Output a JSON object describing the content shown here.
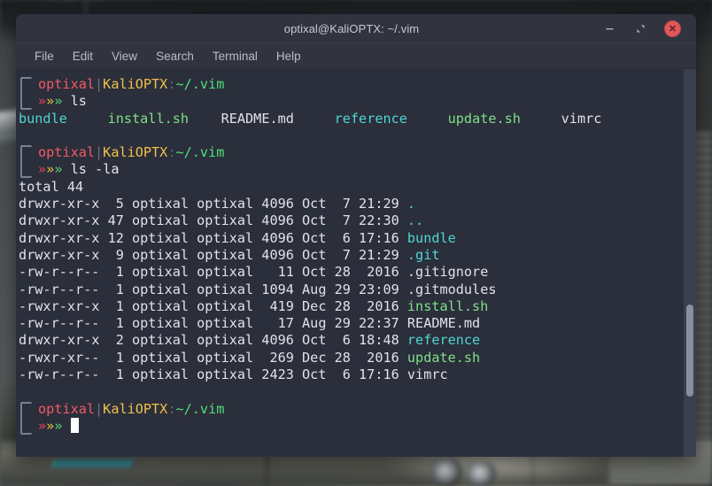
{
  "window": {
    "title": "optixal@KaliOPTX: ~/.vim",
    "controls": {
      "minimize": "minimize-button",
      "maximize": "maximize-button",
      "close_glyph": "✕"
    }
  },
  "menubar": {
    "items": [
      {
        "label": "File"
      },
      {
        "label": "Edit"
      },
      {
        "label": "View"
      },
      {
        "label": "Search"
      },
      {
        "label": "Terminal"
      },
      {
        "label": "Help"
      }
    ]
  },
  "prompt": {
    "user": "optixal",
    "separator": "|",
    "host": "KaliOPTX",
    "colon": ":",
    "path": "~/.vim",
    "arrow": "»"
  },
  "terminal": {
    "commands": {
      "first": "ls",
      "second": "ls -la"
    },
    "ls_entries": [
      {
        "name": "bundle",
        "type": "dir"
      },
      {
        "name": "install.sh",
        "type": "exec"
      },
      {
        "name": "README.md",
        "type": "file"
      },
      {
        "name": "reference",
        "type": "dir"
      },
      {
        "name": "update.sh",
        "type": "exec"
      },
      {
        "name": "vimrc",
        "type": "file"
      }
    ],
    "total_line": "total 44",
    "long_listing": [
      {
        "perms": "drwxr-xr-x",
        "links": "5",
        "owner": "optixal",
        "group": "optixal",
        "size": "4096",
        "month": "Oct",
        "day": "7",
        "time": "21:29",
        "name": ".",
        "type": "dir"
      },
      {
        "perms": "drwxr-xr-x",
        "links": "47",
        "owner": "optixal",
        "group": "optixal",
        "size": "4096",
        "month": "Oct",
        "day": "7",
        "time": "22:30",
        "name": "..",
        "type": "dir"
      },
      {
        "perms": "drwxr-xr-x",
        "links": "12",
        "owner": "optixal",
        "group": "optixal",
        "size": "4096",
        "month": "Oct",
        "day": "6",
        "time": "17:16",
        "name": "bundle",
        "type": "dir"
      },
      {
        "perms": "drwxr-xr-x",
        "links": "9",
        "owner": "optixal",
        "group": "optixal",
        "size": "4096",
        "month": "Oct",
        "day": "7",
        "time": "21:29",
        "name": ".git",
        "type": "dir"
      },
      {
        "perms": "-rw-r--r--",
        "links": "1",
        "owner": "optixal",
        "group": "optixal",
        "size": "11",
        "month": "Oct",
        "day": "28",
        "time": "2016",
        "name": ".gitignore",
        "type": "file"
      },
      {
        "perms": "-rw-r--r--",
        "links": "1",
        "owner": "optixal",
        "group": "optixal",
        "size": "1094",
        "month": "Aug",
        "day": "29",
        "time": "23:09",
        "name": ".gitmodules",
        "type": "file"
      },
      {
        "perms": "-rwxr-xr-x",
        "links": "1",
        "owner": "optixal",
        "group": "optixal",
        "size": "419",
        "month": "Dec",
        "day": "28",
        "time": "2016",
        "name": "install.sh",
        "type": "exec"
      },
      {
        "perms": "-rw-r--r--",
        "links": "1",
        "owner": "optixal",
        "group": "optixal",
        "size": "17",
        "month": "Aug",
        "day": "29",
        "time": "22:37",
        "name": "README.md",
        "type": "file"
      },
      {
        "perms": "drwxr-xr-x",
        "links": "2",
        "owner": "optixal",
        "group": "optixal",
        "size": "4096",
        "month": "Oct",
        "day": "6",
        "time": "18:48",
        "name": "reference",
        "type": "dir"
      },
      {
        "perms": "-rwxr-xr--",
        "links": "1",
        "owner": "optixal",
        "group": "optixal",
        "size": "269",
        "month": "Dec",
        "day": "28",
        "time": "2016",
        "name": "update.sh",
        "type": "exec"
      },
      {
        "perms": "-rw-r--r--",
        "links": "1",
        "owner": "optixal",
        "group": "optixal",
        "size": "2423",
        "month": "Oct",
        "day": "6",
        "time": "17:16",
        "name": "vimrc",
        "type": "file"
      }
    ]
  },
  "colors": {
    "terminal_bg": "#2b2e3b",
    "titlebar_bg": "#31343f",
    "user": "#f05b65",
    "host": "#f0c249",
    "path": "#4ee07a",
    "directory": "#4fd6d2",
    "executable": "#7ee08a",
    "plain_text": "#dfe3e9",
    "close_button": "#e2575c"
  }
}
